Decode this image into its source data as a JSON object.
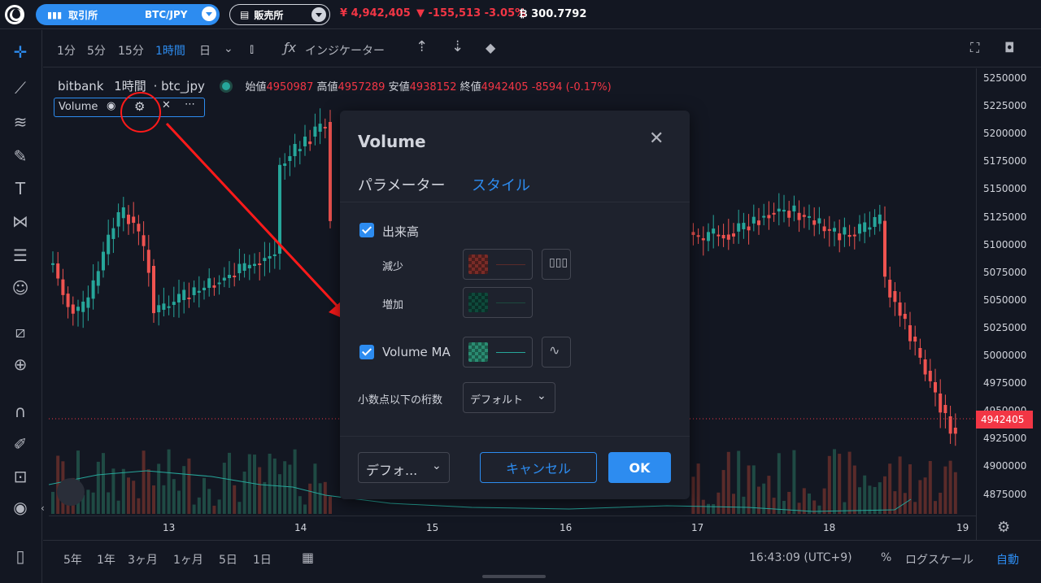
{
  "topbar": {
    "exchange_label": "取引所",
    "pair": "BTC/JPY",
    "sales_label": "販売所",
    "price": "¥ 4,942,405",
    "change": "-155,513 -3.05%",
    "btc_balance": "300.7792",
    "colors": {
      "down": "#f23645",
      "accent": "#2d8cf0"
    }
  },
  "timeframes": [
    "1分",
    "5分",
    "15分",
    "1時間",
    "日"
  ],
  "active_timeframe": "1時間",
  "indicators_label": "インジケーター",
  "legend": {
    "exchange": "bitbank",
    "interval": "1時間",
    "symbol": "btc_jpy",
    "open_label": "始値",
    "open": "4950987",
    "high_label": "高値",
    "high": "4957289",
    "low_label": "安値",
    "low": "4938152",
    "close_label": "終値",
    "close": "4942405",
    "change": "-8594 (-0.17%)"
  },
  "volume_legend": {
    "name": "Volume"
  },
  "price_axis": {
    "ticks": [
      "5250000",
      "5225000",
      "5200000",
      "5175000",
      "5150000",
      "5125000",
      "5100000",
      "5075000",
      "5050000",
      "5025000",
      "5000000",
      "4975000",
      "4950000",
      "4925000",
      "4900000",
      "4875000"
    ],
    "current": "4942405"
  },
  "time_axis": {
    "ticks": [
      "13",
      "14",
      "15",
      "16",
      "17",
      "18",
      "19"
    ]
  },
  "bottombar": {
    "ranges": [
      "5年",
      "1年",
      "3ヶ月",
      "1ヶ月",
      "5日",
      "1日"
    ],
    "clock": "16:43:09 (UTC+9)",
    "percent": "%",
    "log": "ログスケール",
    "auto": "自動"
  },
  "dialog": {
    "title": "Volume",
    "tab_params": "パラメーター",
    "tab_style": "スタイル",
    "volume_label": "出来高",
    "decrease_label": "減少",
    "increase_label": "増加",
    "volume_ma_label": "Volume MA",
    "decimals_label": "小数点以下の桁数",
    "decimals_value": "デフォルト",
    "defaults_value": "デフォ...",
    "cancel": "キャンセル",
    "ok": "OK",
    "colors": {
      "decrease": "#7a2b27",
      "increase": "#0e4a3b",
      "ma": "#2a8c72"
    }
  },
  "chart_data": {
    "type": "candlestick",
    "x": [
      "13",
      "14",
      "15",
      "16",
      "17",
      "18",
      "19"
    ],
    "ylim": [
      4860000,
      5262000
    ]
  }
}
